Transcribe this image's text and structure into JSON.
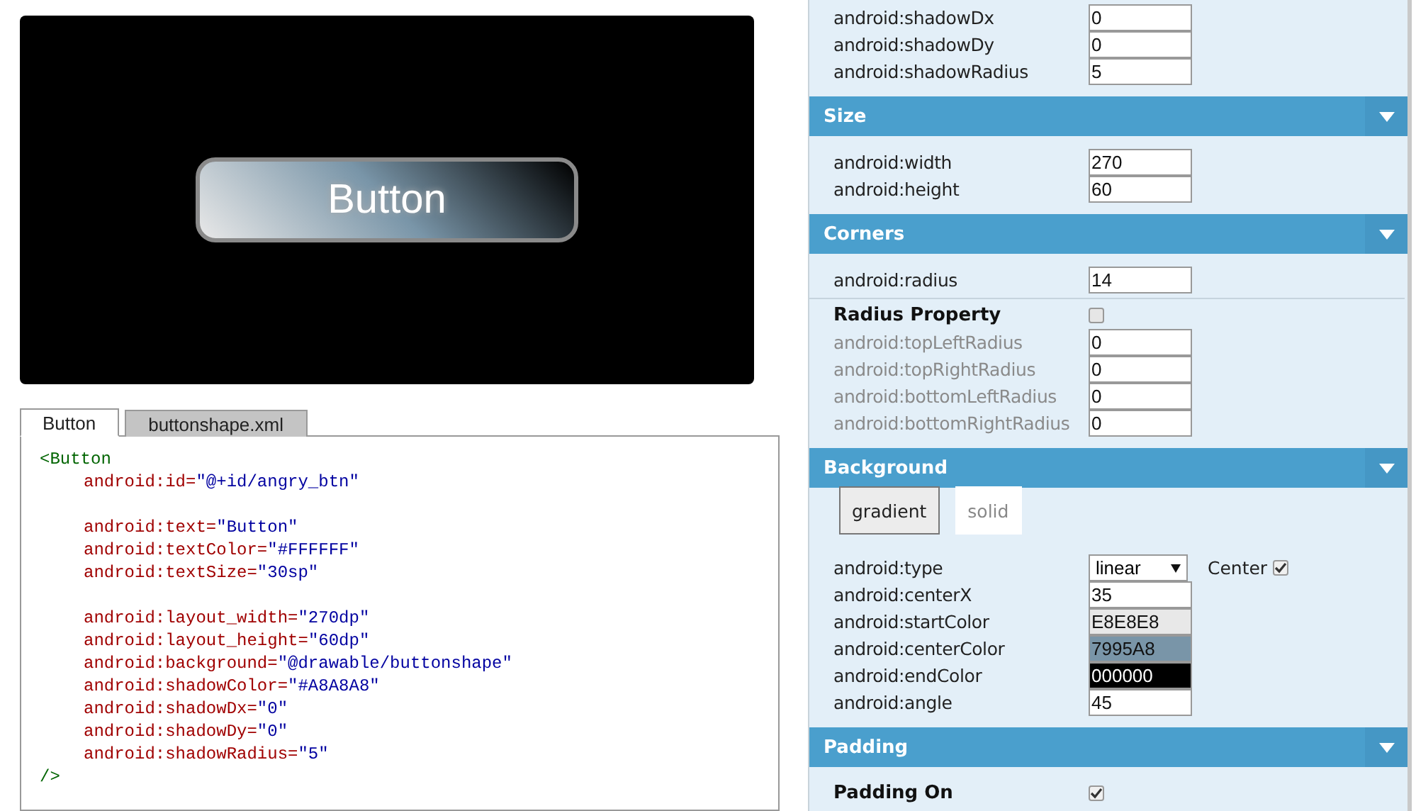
{
  "preview": {
    "button_label": "Button"
  },
  "code_tabs": [
    {
      "label": "Button",
      "selected": true
    },
    {
      "label": "buttonshape.xml",
      "selected": false
    }
  ],
  "code_lines": [
    {
      "kind": "tag",
      "text": "<Button"
    },
    {
      "kind": "attr",
      "name": "android:id=",
      "value": "\"@+id/angry_btn\""
    },
    {
      "kind": "blank"
    },
    {
      "kind": "attr",
      "name": "android:text=",
      "value": "\"Button\""
    },
    {
      "kind": "attr",
      "name": "android:textColor=",
      "value": "\"#FFFFFF\""
    },
    {
      "kind": "attr",
      "name": "android:textSize=",
      "value": "\"30sp\""
    },
    {
      "kind": "blank"
    },
    {
      "kind": "attr",
      "name": "android:layout_width=",
      "value": "\"270dp\""
    },
    {
      "kind": "attr",
      "name": "android:layout_height=",
      "value": "\"60dp\""
    },
    {
      "kind": "attr",
      "name": "android:background=",
      "value": "\"@drawable/buttonshape\""
    },
    {
      "kind": "attr",
      "name": "android:shadowColor=",
      "value": "\"#A8A8A8\""
    },
    {
      "kind": "attr",
      "name": "android:shadowDx=",
      "value": "\"0\""
    },
    {
      "kind": "attr",
      "name": "android:shadowDy=",
      "value": "\"0\""
    },
    {
      "kind": "attr",
      "name": "android:shadowRadius=",
      "value": "\"5\""
    },
    {
      "kind": "tag",
      "text": "/>"
    }
  ],
  "sections": [
    {
      "rows": [
        {
          "kind": "field",
          "label": "android:shadowDx",
          "value": "0",
          "disabled": false
        },
        {
          "kind": "field",
          "label": "android:shadowDy",
          "value": "0",
          "disabled": false
        },
        {
          "kind": "field",
          "label": "android:shadowRadius",
          "value": "5",
          "disabled": false
        }
      ]
    },
    {
      "title": "Size",
      "rows": [
        {
          "kind": "field",
          "label": "android:width",
          "value": "270",
          "disabled": false
        },
        {
          "kind": "field",
          "label": "android:height",
          "value": "60",
          "disabled": false
        }
      ]
    },
    {
      "title": "Corners",
      "rows": [
        {
          "kind": "field",
          "label": "android:radius",
          "value": "14",
          "disabled": false
        },
        {
          "kind": "divider"
        },
        {
          "kind": "toggle",
          "label": "Radius Property",
          "checked": false
        },
        {
          "kind": "field",
          "label": "android:topLeftRadius",
          "value": "0",
          "disabled": true
        },
        {
          "kind": "field",
          "label": "android:topRightRadius",
          "value": "0",
          "disabled": true
        },
        {
          "kind": "field",
          "label": "android:bottomLeftRadius",
          "value": "0",
          "disabled": true
        },
        {
          "kind": "field",
          "label": "android:bottomRightRadius",
          "value": "0",
          "disabled": true
        }
      ]
    },
    {
      "title": "Background",
      "rows": [
        {
          "kind": "buttons",
          "options": [
            {
              "label": "gradient",
              "selected": true
            },
            {
              "label": "solid",
              "selected": false
            }
          ]
        },
        {
          "kind": "select",
          "label": "android:type",
          "value": "linear",
          "option_label": "Center",
          "checked": true
        },
        {
          "kind": "field",
          "label": "android:centerX",
          "value": "35",
          "disabled": false
        },
        {
          "kind": "color",
          "label": "android:startColor",
          "value": "E8E8E8",
          "color": "#e8e8e8"
        },
        {
          "kind": "color",
          "label": "android:centerColor",
          "value": "7995A8",
          "color": "#7995a8"
        },
        {
          "kind": "color",
          "label": "android:endColor",
          "value": "000000",
          "color": "#000000"
        },
        {
          "kind": "field",
          "label": "android:angle",
          "value": "45",
          "disabled": false
        }
      ]
    },
    {
      "title": "Padding",
      "rows": [
        {
          "kind": "toggle",
          "label": "Padding On",
          "checked": true
        }
      ]
    }
  ]
}
